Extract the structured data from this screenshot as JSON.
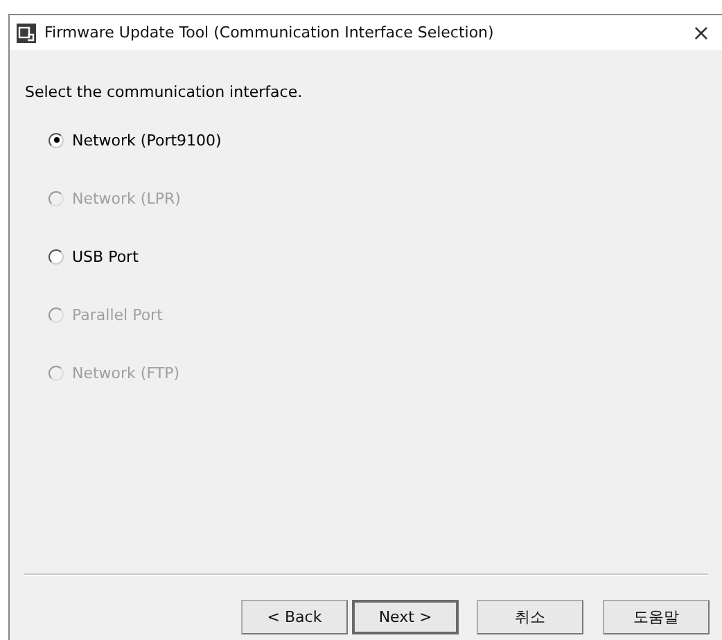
{
  "window": {
    "title": "Firmware Update Tool (Communication Interface Selection)",
    "close": "×"
  },
  "prompt": "Select the communication interface.",
  "options": [
    {
      "label": "Network (Port9100)",
      "selected": true,
      "disabled": false
    },
    {
      "label": "Network (LPR)",
      "selected": false,
      "disabled": true
    },
    {
      "label": "USB Port",
      "selected": false,
      "disabled": false
    },
    {
      "label": "Parallel Port",
      "selected": false,
      "disabled": true
    },
    {
      "label": "Network (FTP)",
      "selected": false,
      "disabled": true
    }
  ],
  "buttons": [
    {
      "label": "< Back",
      "default": false
    },
    {
      "label": "Next >",
      "default": true
    },
    {
      "label": "취소",
      "default": false
    },
    {
      "label": "도움말",
      "default": false
    }
  ]
}
